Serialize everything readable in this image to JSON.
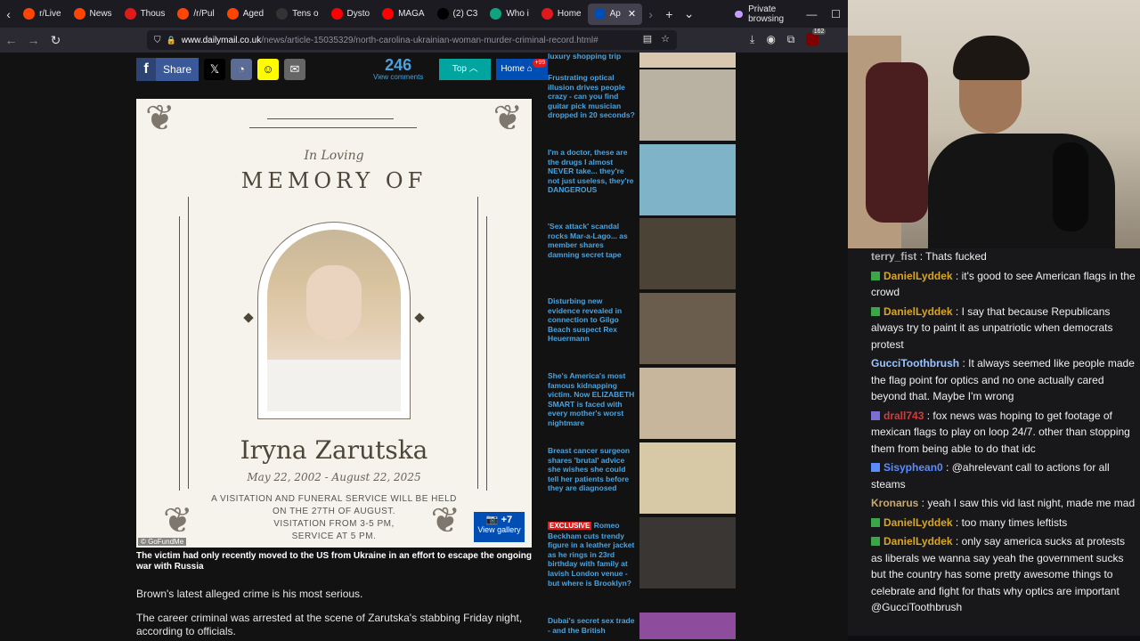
{
  "browser": {
    "tabs": [
      {
        "label": "r/Live",
        "color": "#ff4500"
      },
      {
        "label": "News",
        "color": "#ff4500"
      },
      {
        "label": "Thous",
        "color": "#e01a1a"
      },
      {
        "label": "/r/Pul",
        "color": "#ff4500"
      },
      {
        "label": "Aged",
        "color": "#ff4500"
      },
      {
        "label": "Tens o",
        "color": "#333333"
      },
      {
        "label": "Dysto",
        "color": "#ff0000"
      },
      {
        "label": "MAGA",
        "color": "#ff0000"
      },
      {
        "label": "(2) C3",
        "color": "#000000"
      },
      {
        "label": "Who i",
        "color": "#10a37f"
      },
      {
        "label": "Home",
        "color": "#e01a1a"
      },
      {
        "label": "Ap",
        "color": "#004db3",
        "active": true
      }
    ],
    "new_tab": "+",
    "private_label": "Private browsing",
    "url_domain": "www.dailymail.co.uk",
    "url_path": "/news/article-15035329/north-carolina-ukrainian-woman-murder-criminal-record.html#",
    "addon_count": "162"
  },
  "page": {
    "share_label": "Share",
    "comment_count": "246",
    "comment_label": "View comments",
    "top_label": "Top",
    "home_label": "Home",
    "home_badge": "+99",
    "memorial": {
      "in_loving": "In Loving",
      "memory_of": "MEMORY OF",
      "name": "Iryna Zarutska",
      "dates": "May 22, 2002 - August 22, 2025",
      "service_line1": "A VISITATION AND FUNERAL SERVICE WILL BE HELD",
      "service_line2": "ON THE 27TH OF AUGUST.",
      "service_line3": "VISITATION FROM 3-5 PM,",
      "service_line4": "SERVICE AT 5 PM.",
      "credit": "© GoFundMe",
      "gallery_count": "+7",
      "gallery_label": "View gallery"
    },
    "caption": "The victim had only recently moved to the US from Ukraine in an effort to escape the ongoing war with Russia",
    "paragraphs": [
      "Brown's latest alleged crime is his most serious.",
      "The career criminal was arrested at the scene of Zarutska's stabbing Friday night, according to officials."
    ],
    "sidebar": [
      {
        "text": "luxury shopping trip",
        "color": "#d9c7b0"
      },
      {
        "text": "Frustrating optical illusion drives people crazy - can you find guitar pick musician dropped in 20 seconds?",
        "color": "#b9b2a3"
      },
      {
        "text": "I'm a doctor, these are the drugs I almost NEVER take... they're not just useless, they're DANGEROUS",
        "color": "#7fb3c8"
      },
      {
        "text": "'Sex attack' scandal rocks Mar-a-Lago... as member shares damning secret tape",
        "color": "#4a4336"
      },
      {
        "text": "Disturbing new evidence revealed in connection to Gilgo Beach suspect Rex Heuermann",
        "color": "#6b5d4e"
      },
      {
        "text": "She's America's most famous kidnapping victim. Now ELIZABETH SMART is faced with every mother's worst nightmare",
        "color": "#c7b59c"
      },
      {
        "text": "Breast cancer surgeon shares 'brutal' advice she wishes she could tell her patients before they are diagnosed",
        "color": "#d8c9a6"
      },
      {
        "exclusive": "EXCLUSIVE",
        "text": "Romeo Beckham cuts trendy figure in a leather jacket as he rings in 23rd birthday with family at lavish London venue - but where is Brooklyn?",
        "color": "#3a3633"
      },
      {
        "text": "Dubai's secret sex trade - and the British",
        "color": "#8e4c9c"
      }
    ]
  },
  "chat": [
    {
      "user": "terry_fist",
      "color": "#b0b0b0",
      "text": "Thats fucked",
      "badge": ""
    },
    {
      "user": "DanielLyddek",
      "color": "#daa520",
      "text": "it's good to see American flags in the crowd",
      "badge": "#3ba54a"
    },
    {
      "user": "DanielLyddek",
      "color": "#daa520",
      "text": "I say that because Republicans always try to paint it as unpatriotic when democrats protest",
      "badge": "#3ba54a"
    },
    {
      "user": "GucciToothbrush",
      "color": "#9ac4ff",
      "text": "It always seemed like people made the flag point for optics and no one actually cared beyond that. Maybe I'm wrong",
      "badge": ""
    },
    {
      "user": "drall743",
      "color": "#d23c3c",
      "text": "fox news was hoping to get footage of mexican flags to play on loop 24/7. other than stopping them from being able to do that idc",
      "badge": "#7a6fd1"
    },
    {
      "user": "Sisyphean0",
      "color": "#5b8cff",
      "text": "@ahrelevant call to actions for all steams",
      "badge": "#5b8cff"
    },
    {
      "user": "Kronarus",
      "color": "#c9a96e",
      "text": "yeah I saw this vid last night, made me mad",
      "badge": ""
    },
    {
      "user": "DanielLyddek",
      "color": "#daa520",
      "text": "too many times leftists",
      "badge": "#3ba54a"
    },
    {
      "user": "DanielLyddek",
      "color": "#daa520",
      "text": "only say america sucks at protests as liberals we wanna say yeah the government sucks but the country has some pretty awesome things to celebrate and fight for thats why optics are important @GucciToothbrush",
      "badge": "#3ba54a"
    }
  ]
}
